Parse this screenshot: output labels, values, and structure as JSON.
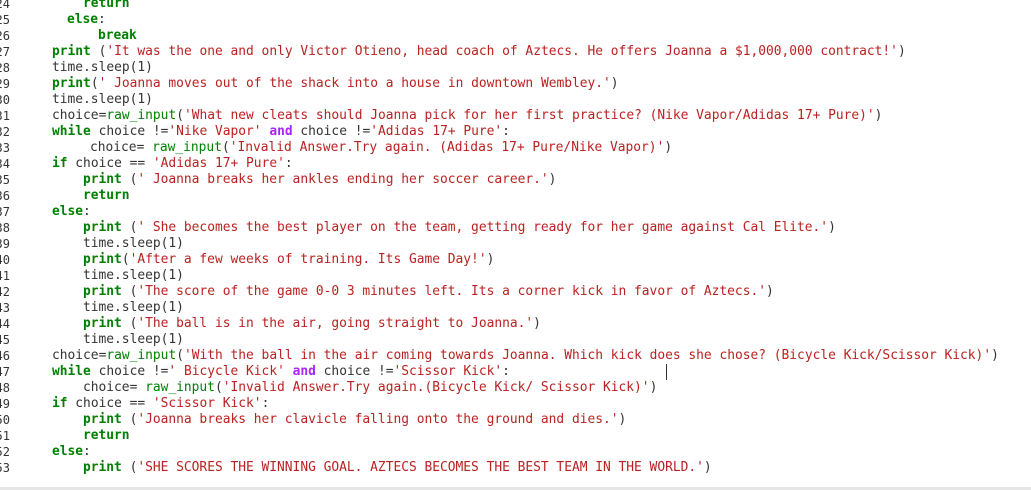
{
  "editor": {
    "line_numbers": [
      "24",
      "25",
      "26",
      "27",
      "28",
      "29",
      "30",
      "31",
      "32",
      "33",
      "34",
      "35",
      "36",
      "37",
      "38",
      "39",
      "40",
      "41",
      "42",
      "43",
      "44",
      "45",
      "46",
      "47",
      "48",
      "49",
      "50",
      "51",
      "52",
      "53"
    ],
    "lines": [
      {
        "indent": 10,
        "tokens": [
          [
            "kw",
            "return"
          ]
        ]
      },
      {
        "indent": 8,
        "tokens": [
          [
            "kw",
            "else"
          ],
          [
            "",
            ":"
          ]
        ]
      },
      {
        "indent": 12,
        "tokens": [
          [
            "kw",
            "break"
          ]
        ]
      },
      {
        "indent": 6,
        "tokens": [
          [
            "kw",
            "print"
          ],
          [
            "",
            " ("
          ],
          [
            "str",
            "'It was the one and only Victor Otieno, head coach of Aztecs. He offers Joanna a $1,000,000 contract!'"
          ],
          [
            "",
            ")"
          ]
        ]
      },
      {
        "indent": 6,
        "tokens": [
          [
            "",
            "time.sleep(1)"
          ]
        ]
      },
      {
        "indent": 6,
        "tokens": [
          [
            "kw",
            "print"
          ],
          [
            "",
            "("
          ],
          [
            "str",
            "' Joanna moves out of the shack into a house in downtown Wembley.'"
          ],
          [
            "",
            ")"
          ]
        ]
      },
      {
        "indent": 6,
        "tokens": [
          [
            "",
            "time.sleep(1)"
          ]
        ]
      },
      {
        "indent": 6,
        "tokens": [
          [
            "",
            "choice="
          ],
          [
            "fn",
            "raw_input"
          ],
          [
            "",
            "("
          ],
          [
            "str",
            "'What new cleats should Joanna pick for her first practice? (Nike Vapor/Adidas 17+ Pure)'"
          ],
          [
            "",
            ")"
          ]
        ]
      },
      {
        "indent": 6,
        "tokens": [
          [
            "kw",
            "while"
          ],
          [
            "",
            " choice !="
          ],
          [
            "str",
            "'Nike Vapor'"
          ],
          [
            "",
            " "
          ],
          [
            "op",
            "and"
          ],
          [
            "",
            " choice !="
          ],
          [
            "str",
            "'Adidas 17+ Pure'"
          ],
          [
            "",
            ":"
          ]
        ]
      },
      {
        "indent": 11,
        "tokens": [
          [
            "",
            "choice= "
          ],
          [
            "fn",
            "raw_input"
          ],
          [
            "",
            "("
          ],
          [
            "str",
            "'Invalid Answer.Try again. (Adidas 17+ Pure/Nike Vapor)'"
          ],
          [
            "",
            ")"
          ]
        ]
      },
      {
        "indent": 6,
        "tokens": [
          [
            "kw",
            "if"
          ],
          [
            "",
            " choice == "
          ],
          [
            "str",
            "'Adidas 17+ Pure'"
          ],
          [
            "",
            ":"
          ]
        ]
      },
      {
        "indent": 10,
        "tokens": [
          [
            "kw",
            "print"
          ],
          [
            "",
            " ("
          ],
          [
            "str",
            "' Joanna breaks her ankles ending her soccer career.'"
          ],
          [
            "",
            ")"
          ]
        ]
      },
      {
        "indent": 10,
        "tokens": [
          [
            "kw",
            "return"
          ]
        ]
      },
      {
        "indent": 6,
        "tokens": [
          [
            "kw",
            "else"
          ],
          [
            "",
            ":"
          ]
        ]
      },
      {
        "indent": 10,
        "tokens": [
          [
            "kw",
            "print"
          ],
          [
            "",
            " ("
          ],
          [
            "str",
            "' She becomes the best player on the team, getting ready for her game against Cal Elite.'"
          ],
          [
            "",
            ")"
          ]
        ]
      },
      {
        "indent": 10,
        "tokens": [
          [
            "",
            "time.sleep(1)"
          ]
        ]
      },
      {
        "indent": 10,
        "tokens": [
          [
            "kw",
            "print"
          ],
          [
            "",
            "("
          ],
          [
            "str",
            "'After a few weeks of training. Its Game Day!'"
          ],
          [
            "",
            ")"
          ]
        ]
      },
      {
        "indent": 10,
        "tokens": [
          [
            "",
            "time.sleep(1)"
          ]
        ]
      },
      {
        "indent": 10,
        "tokens": [
          [
            "kw",
            "print"
          ],
          [
            "",
            " ("
          ],
          [
            "str",
            "'The score of the game 0-0 3 minutes left. Its a corner kick in favor of Aztecs.'"
          ],
          [
            "",
            ")"
          ]
        ]
      },
      {
        "indent": 10,
        "tokens": [
          [
            "",
            "time.sleep(1)"
          ]
        ]
      },
      {
        "indent": 10,
        "tokens": [
          [
            "kw",
            "print"
          ],
          [
            "",
            " ("
          ],
          [
            "str",
            "'The ball is in the air, going straight to Joanna.'"
          ],
          [
            "",
            ")"
          ]
        ]
      },
      {
        "indent": 10,
        "tokens": [
          [
            "",
            "time.sleep(1)"
          ]
        ]
      },
      {
        "indent": 6,
        "tokens": [
          [
            "",
            "choice="
          ],
          [
            "fn",
            "raw_input"
          ],
          [
            "",
            "("
          ],
          [
            "str",
            "'With the ball in the air coming towards Joanna. Which kick does she chose? (Bicycle Kick/Scissor Kick)'"
          ],
          [
            "",
            ")"
          ]
        ]
      },
      {
        "indent": 6,
        "tokens": [
          [
            "kw",
            "while"
          ],
          [
            "",
            " choice !="
          ],
          [
            "str",
            "' Bicycle Kick'"
          ],
          [
            "",
            " "
          ],
          [
            "op",
            "and"
          ],
          [
            "",
            " choice !="
          ],
          [
            "str",
            "'Scissor Kick'"
          ],
          [
            "",
            ":"
          ]
        ]
      },
      {
        "indent": 10,
        "tokens": [
          [
            "",
            "choice= "
          ],
          [
            "fn",
            "raw_input"
          ],
          [
            "",
            "("
          ],
          [
            "str",
            "'Invalid Answer.Try again.(Bicycle Kick/ Scissor Kick)'"
          ],
          [
            "",
            ")"
          ]
        ]
      },
      {
        "indent": 6,
        "tokens": [
          [
            "kw",
            "if"
          ],
          [
            "",
            " choice == "
          ],
          [
            "str",
            "'Scissor Kick'"
          ],
          [
            "",
            ":"
          ]
        ]
      },
      {
        "indent": 10,
        "tokens": [
          [
            "kw",
            "print"
          ],
          [
            "",
            " ("
          ],
          [
            "str",
            "'Joanna breaks her clavicle falling onto the ground and dies.'"
          ],
          [
            "",
            ")"
          ]
        ]
      },
      {
        "indent": 10,
        "tokens": [
          [
            "kw",
            "return"
          ]
        ]
      },
      {
        "indent": 6,
        "tokens": [
          [
            "kw",
            "else"
          ],
          [
            "",
            ":"
          ]
        ]
      },
      {
        "indent": 10,
        "tokens": [
          [
            "kw",
            "print"
          ],
          [
            "",
            " ("
          ],
          [
            "str",
            "'SHE SCORES THE WINNING GOAL. AZTECS BECOMES THE BEST TEAM IN THE WORLD.'"
          ],
          [
            "",
            ")"
          ]
        ]
      }
    ]
  }
}
